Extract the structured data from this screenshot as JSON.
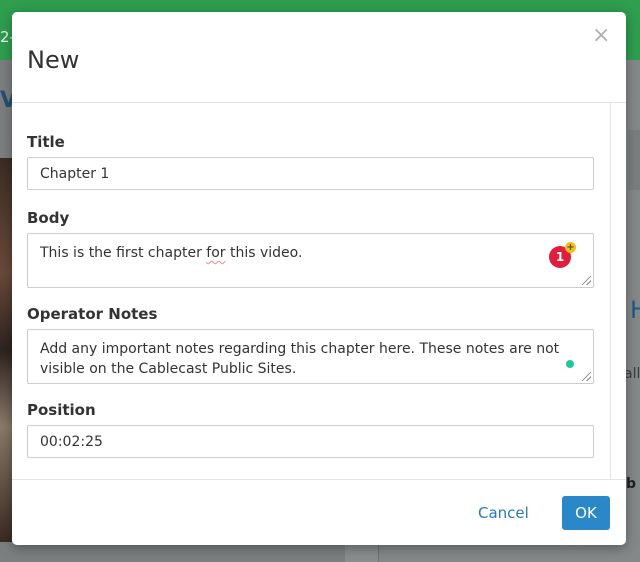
{
  "background": {
    "topbar_fragment": "2-",
    "left_heading_fragment": "V",
    "right_heading_fragment": "H",
    "right_text_fragment": "all",
    "right_bold_fragment": "b"
  },
  "modal": {
    "title": "New",
    "close_glyph": "×",
    "fields": {
      "title": {
        "label": "Title",
        "value": "Chapter 1"
      },
      "body": {
        "label": "Body",
        "value_before": "This is the first chapter ",
        "value_flagged": "for",
        "value_after": " this video.",
        "grammar_count": "1",
        "grammar_plus": "+"
      },
      "operator_notes": {
        "label": "Operator Notes",
        "value": "Add any important notes regarding this chapter here. These notes are not visible on the Cablecast Public Sites."
      },
      "position": {
        "label": "Position",
        "value": "00:02:25"
      }
    },
    "footer": {
      "cancel_label": "Cancel",
      "ok_label": "OK"
    }
  },
  "colors": {
    "brand_green": "#2f9e4f",
    "primary_button": "#2b88c8",
    "link": "#2a78b6",
    "grammar_badge": "#e01e3c",
    "grammar_ok_dot": "#1cc79e"
  },
  "icons": [
    "close-icon",
    "resize-grip-icon",
    "grammar-check-icon"
  ]
}
